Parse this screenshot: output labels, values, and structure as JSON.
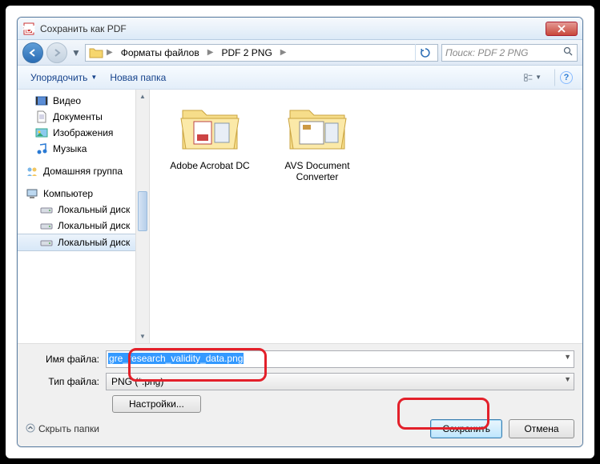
{
  "window": {
    "title": "Сохранить как PDF"
  },
  "breadcrumb": {
    "segments": [
      "Форматы файлов",
      "PDF 2 PNG"
    ]
  },
  "search": {
    "placeholder": "Поиск: PDF 2 PNG"
  },
  "toolbar": {
    "organize": "Упорядочить",
    "new_folder": "Новая папка"
  },
  "sidebar": {
    "libs": [
      "Видео",
      "Документы",
      "Изображения",
      "Музыка"
    ],
    "homegroup": "Домашняя группа",
    "computer": "Компьютер",
    "drives": [
      "Локальный диск",
      "Локальный диск",
      "Локальный диск"
    ]
  },
  "folders": [
    {
      "name": "Adobe Acrobat DC"
    },
    {
      "name": "AVS Document Converter"
    }
  ],
  "fields": {
    "filename_label": "Имя файла:",
    "filename_value": "gre_research_validity_data.png",
    "filetype_label": "Тип файла:",
    "filetype_value": "PNG (*.png)"
  },
  "buttons": {
    "settings": "Настройки...",
    "hide_folders": "Скрыть папки",
    "save": "Сохранить",
    "cancel": "Отмена"
  }
}
